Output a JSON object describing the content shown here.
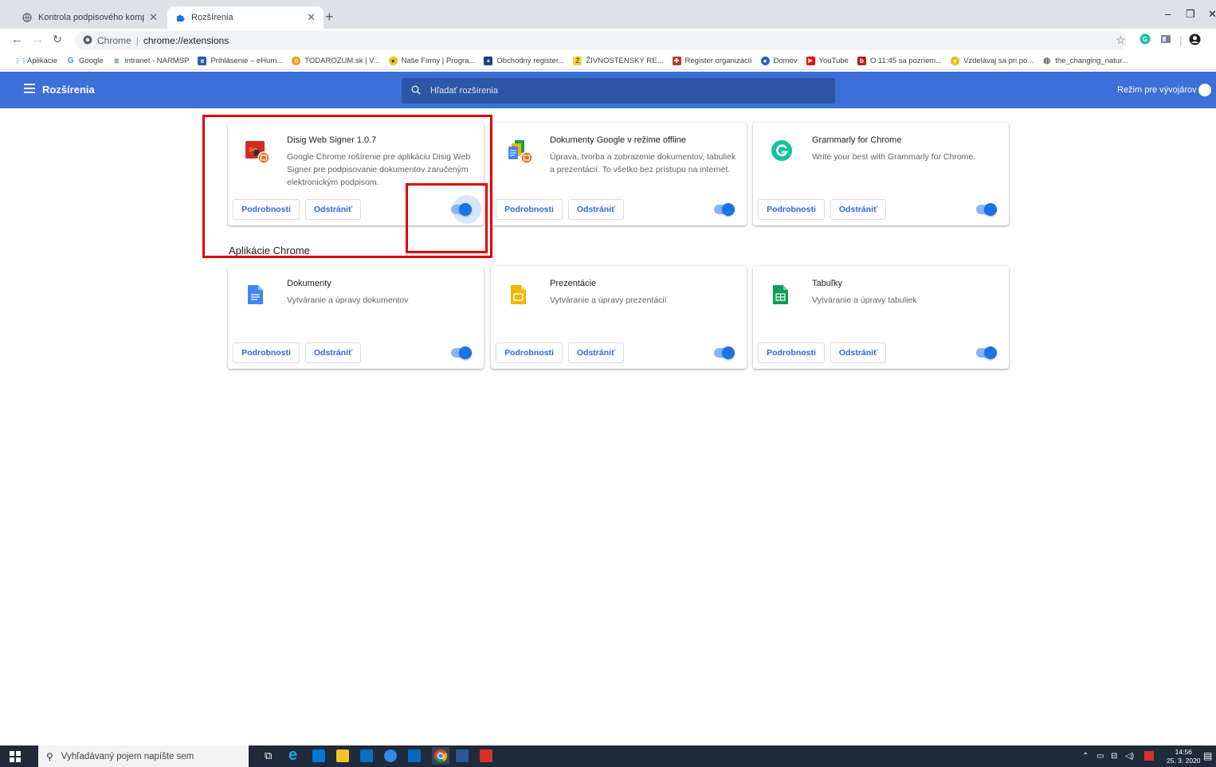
{
  "browser": {
    "tabs": [
      {
        "title": "Kontrola podpisového kompone",
        "active": false
      },
      {
        "title": "Rozšírenia",
        "active": true
      }
    ],
    "new_tab": "+",
    "omnibox": {
      "site_label": "Chrome",
      "url": "chrome://extensions"
    },
    "bookmarks": [
      {
        "label": "Aplikácie",
        "icon": "apps-grid-icon"
      },
      {
        "label": "Google",
        "icon": "google-icon"
      },
      {
        "label": "intranet - NARMSP",
        "icon": "intranet-icon"
      },
      {
        "label": "Prihlásenie – eHum...",
        "icon": "ehum-icon"
      },
      {
        "label": "TODAROZUM.sk | V...",
        "icon": "todarozum-icon"
      },
      {
        "label": "Naše Firmy | Progra...",
        "icon": "nasefirmy-icon"
      },
      {
        "label": "Obchodný register...",
        "icon": "obchodny-register-icon"
      },
      {
        "label": "ŽIVNOSTENSKÝ RE...",
        "icon": "zivnostensky-icon"
      },
      {
        "label": "Register organizácií",
        "icon": "register-org-icon"
      },
      {
        "label": "Domov",
        "icon": "domov-icon"
      },
      {
        "label": "YouTube",
        "icon": "youtube-icon"
      },
      {
        "label": "O 11:45 sa pozriem...",
        "icon": "bookmark-b-icon"
      },
      {
        "label": "Vzdelávaj sa pri po...",
        "icon": "vzdelavaj-icon"
      },
      {
        "label": "the_changing_natur...",
        "icon": "globe-icon"
      }
    ]
  },
  "header": {
    "title": "Rozšírenia",
    "search_placeholder": "Hľadať rozšírenia",
    "dev_mode_label": "Režim pre vývojárov"
  },
  "buttons": {
    "details": "Podrobnosti",
    "remove": "Odstrániť"
  },
  "extensions": [
    {
      "name": "Disig Web Signer 1.0.7",
      "description": "Google Chrome rošírenie pre aplikáciu Disig Web Signer pre podpisovanie dokumentov zaručeným elektronickým podpisom.",
      "enabled": true
    },
    {
      "name": "Dokumenty Google v režime offline",
      "description": "Úprava, tvorba a zobrazenie dokumentov, tabuliek a prezentácií. To všetko bez prístupu na internet.",
      "enabled": true
    },
    {
      "name": "Grammarly for Chrome",
      "description": "Write your best with Grammarly for Chrome.",
      "enabled": true
    }
  ],
  "apps_section_title": "Aplikácie Chrome",
  "apps": [
    {
      "name": "Dokumenty",
      "description": "Vytváranie a úpravy dokumentov",
      "enabled": true
    },
    {
      "name": "Prezentácie",
      "description": "Vytváranie a úpravy prezentácií",
      "enabled": true
    },
    {
      "name": "Tabuľky",
      "description": "Vytváranie a úpravy tabuliek",
      "enabled": true
    }
  ],
  "taskbar": {
    "search_placeholder": "Vyhľadávaný pojem napíšte sem",
    "time": "14:56",
    "date": "25. 3. 2020"
  },
  "colors": {
    "header_blue": "#3c6fd8",
    "toggle_blue": "#1a73e8",
    "highlight_red": "#e00000"
  }
}
